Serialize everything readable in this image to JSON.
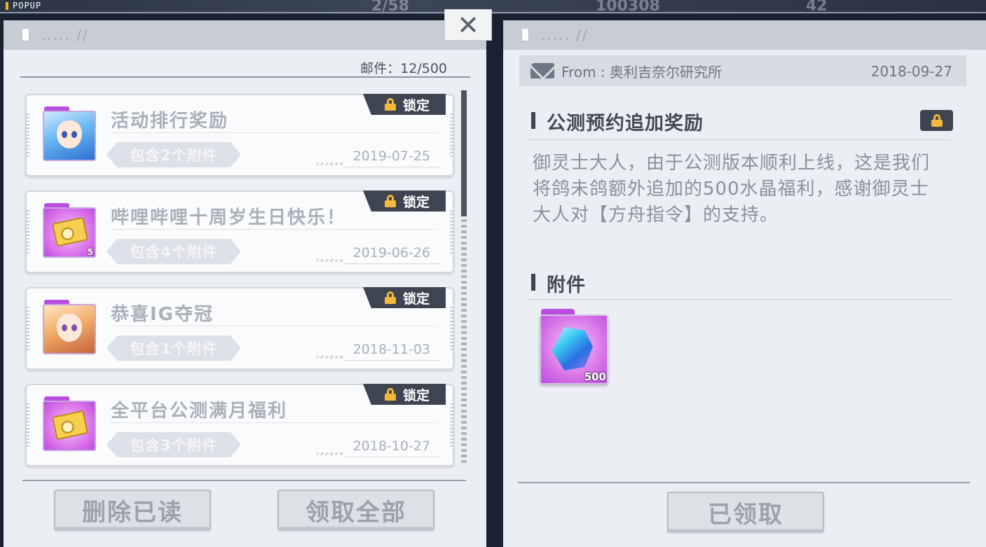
{
  "popup_label": "POPUP",
  "hud": {
    "item1": "2/58",
    "item2": "100308",
    "item3": "42"
  },
  "left_panel": {
    "header_text": "..... //",
    "close_icon": "✕",
    "mail_count_label": "邮件：12/500",
    "mails": [
      {
        "title": "活动排行奖励",
        "attach_label": "包含2个附件",
        "date": "2019-07-25",
        "lock_label": "锁定",
        "thumb": "anime-blue-icon",
        "qty": ""
      },
      {
        "title": "哔哩哔哩十周岁生日快乐！",
        "attach_label": "包含4个附件",
        "date": "2019-06-26",
        "lock_label": "锁定",
        "thumb": "ticket-icon",
        "qty": "5"
      },
      {
        "title": "恭喜IG夺冠",
        "attach_label": "包含1个附件",
        "date": "2018-11-03",
        "lock_label": "锁定",
        "thumb": "anime-orange-icon",
        "qty": ""
      },
      {
        "title": "全平台公测满月福利",
        "attach_label": "包含3个附件",
        "date": "2018-10-27",
        "lock_label": "锁定",
        "thumb": "ticket-icon",
        "qty": ""
      }
    ],
    "delete_read_label": "删除已读",
    "claim_all_label": "领取全部"
  },
  "right_panel": {
    "header_text": "..... //",
    "from_label": "From : 奥利吉奈尔研究所",
    "date": "2018-09-27",
    "title": "公测预约追加奖励",
    "body": "御灵士大人，由于公测版本顺利上线，这是我们将鸽未鸽额外追加的500水晶福利，感谢御灵士大人对【方舟指令】的支持。",
    "attachments_title": "附件",
    "attachments": [
      {
        "icon": "crystal-icon",
        "qty": "500"
      }
    ],
    "claimed_label": "已领取"
  }
}
